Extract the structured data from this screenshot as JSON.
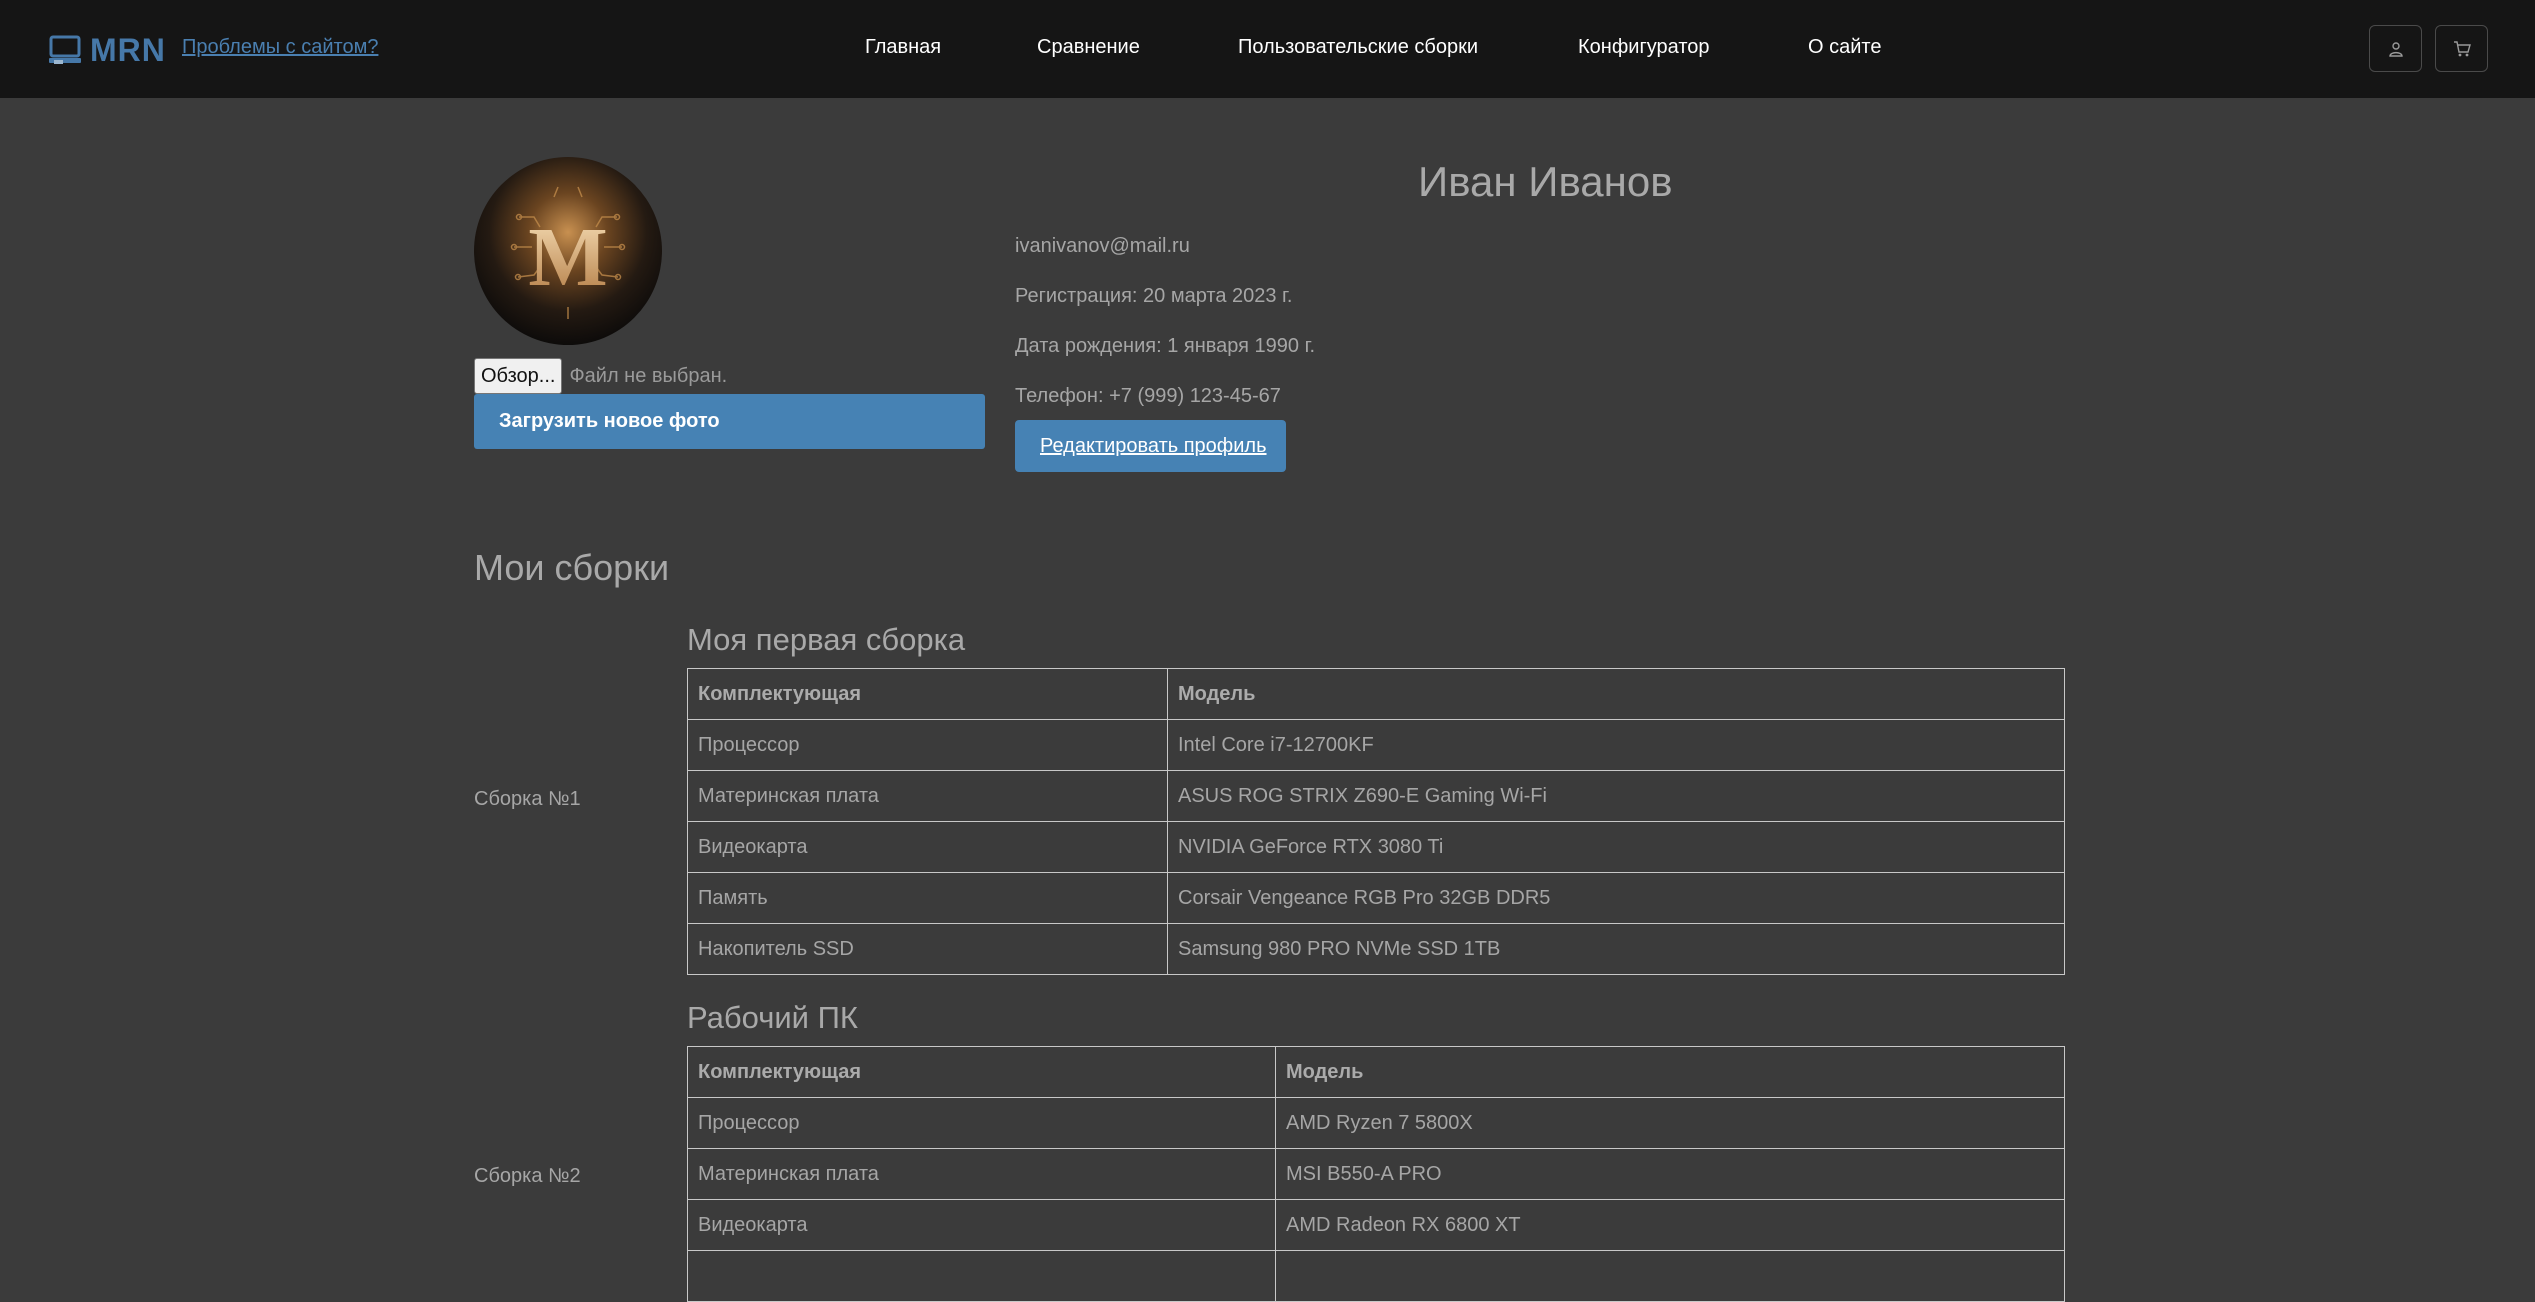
{
  "header": {
    "logo_text": "MRN",
    "problems_link": "Проблемы с сайтом?",
    "nav": [
      "Главная",
      "Сравнение",
      "Пользовательские сборки",
      "Конфигуратор",
      "О сайте"
    ],
    "icons": [
      "user-icon",
      "cart-icon"
    ]
  },
  "profile": {
    "avatar_letter": "M",
    "browse_label": "Обзор...",
    "file_status": "Файл не выбран.",
    "upload_label": "Загрузить новое фото",
    "name": "Иван Иванов",
    "email": "ivanivanov@mail.ru",
    "registration": "Регистрация: 20 марта 2023 г.",
    "birthdate": "Дата рождения: 1 января 1990 г.",
    "phone": "Телефон: +7 (999) 123-45-67",
    "edit_label": "Редактировать профиль"
  },
  "builds": {
    "title": "Мои сборки",
    "col_component": "Комплектующая",
    "col_model": "Модель",
    "items": [
      {
        "label": "Сборка №1",
        "name": "Моя первая сборка",
        "rows": [
          {
            "component": "Процессор",
            "model": "Intel Core i7-12700KF"
          },
          {
            "component": "Материнская плата",
            "model": "ASUS ROG STRIX Z690-E Gaming Wi-Fi"
          },
          {
            "component": "Видеокарта",
            "model": "NVIDIA GeForce RTX 3080 Ti"
          },
          {
            "component": "Память",
            "model": "Corsair Vengeance RGB Pro 32GB DDR5"
          },
          {
            "component": "Накопитель SSD",
            "model": "Samsung 980 PRO NVMe SSD 1TB"
          }
        ]
      },
      {
        "label": "Сборка №2",
        "name": "Рабочий ПК",
        "rows": [
          {
            "component": "Процессор",
            "model": "AMD Ryzen 7 5800X"
          },
          {
            "component": "Материнская плата",
            "model": "MSI B550-A PRO"
          },
          {
            "component": "Видеокарта",
            "model": "AMD Radeon RX 6800 XT"
          },
          {
            "component": "",
            "model": ""
          }
        ]
      }
    ]
  }
}
